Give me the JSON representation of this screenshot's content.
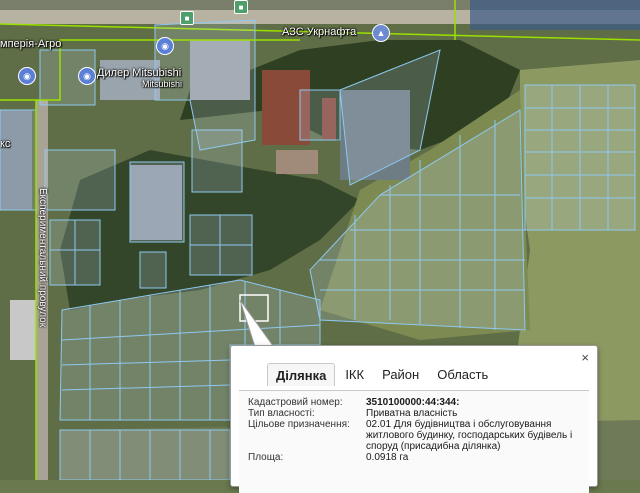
{
  "map_labels": {
    "impex": "мперія-Агро",
    "dealer": "Дилер Mitsubishi",
    "dealer_sub": "Mitsubishi",
    "fuel": "АЗС Укрнафта",
    "street": "Експериментальний провулок",
    "left_fragment": "кс"
  },
  "icons": {
    "shop": "shopping-bag-icon",
    "fuel": "fuel-station-icon",
    "bus": "bus-stop-icon"
  },
  "colors": {
    "parcel_outline": "#8ec9f0",
    "boundary": "#9be000"
  },
  "popup": {
    "close_label": "×",
    "tabs": [
      "Ділянка",
      "ІКК",
      "Район",
      "Область"
    ],
    "active_tab": "Ділянка",
    "fields": [
      {
        "key": "Кадастровий номер:",
        "value": "3510100000:44:344:"
      },
      {
        "key": "Тип власності:",
        "value": "Приватна власність"
      },
      {
        "key": "Цільове призначення:",
        "value": "02.01 Для будівництва і обслуговування житлового будинку, господарських будівель і споруд (присадибна ділянка)"
      },
      {
        "key": "Площа:",
        "value": "0.0918 га"
      }
    ]
  }
}
